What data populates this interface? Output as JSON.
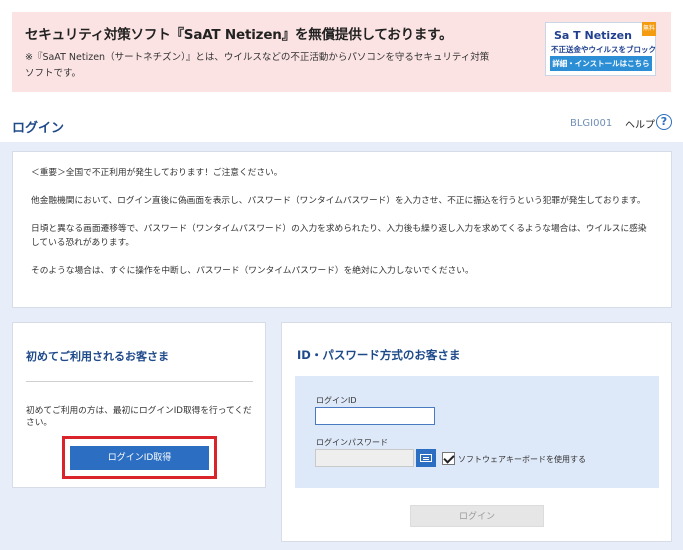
{
  "banner": {
    "title": "セキュリティ対策ソフト『SaAT Netizen』を無償提供しております。",
    "description": "※『SaAT Netizen（サートネチズン）』とは、ウイルスなどの不正活動からパソコンを守るセキュリティ対策ソフトです。",
    "logo_name": "Sa T Netizen",
    "logo_tagline": "不正送金やウイルスをブロック",
    "logo_button": "詳細・インストールはこちら",
    "logo_ribbon": "無料"
  },
  "header": {
    "title": "ログイン",
    "screen_id": "BLGI001",
    "help_label": "ヘルプ",
    "help_icon": "?"
  },
  "notice": {
    "lines": [
      "＜重要＞全国で不正利用が発生しております！ご注意ください。",
      "他金融機関において、ログイン直後に偽画面を表示し、パスワード（ワンタイムパスワード）を入力させ、不正に振込を行うという犯罪が発生しております。",
      "日頃と異なる画面遷移等で、パスワード（ワンタイムパスワード）の入力を求められたり、入力後も繰り返し入力を求めてくるような場合は、ウイルスに感染している恐れがあります。",
      "そのような場合は、すぐに操作を中断し、パスワード（ワンタイムパスワード）を絶対に入力しないでください。"
    ]
  },
  "first_time": {
    "heading": "初めてご利用されるお客さま",
    "description": "初めてご利用の方は、最初にログインID取得を行ってください。",
    "button_label": "ログインID取得"
  },
  "login": {
    "heading": "ID・パスワード方式のお客さま",
    "id_label": "ログインID",
    "id_value": "",
    "password_label": "ログインパスワード",
    "password_value": "",
    "keyboard_icon": "keyboard-icon",
    "software_keyboard_label": "ソフトウェアキーボードを使用する",
    "software_keyboard_checked": true,
    "submit_label": "ログイン"
  },
  "colors": {
    "banner_bg": "#fbe3e3",
    "content_bg": "#e8eef9",
    "accent_blue": "#2b6ec2",
    "heading_blue": "#1e4a8a",
    "highlight_red": "#d9242b"
  }
}
